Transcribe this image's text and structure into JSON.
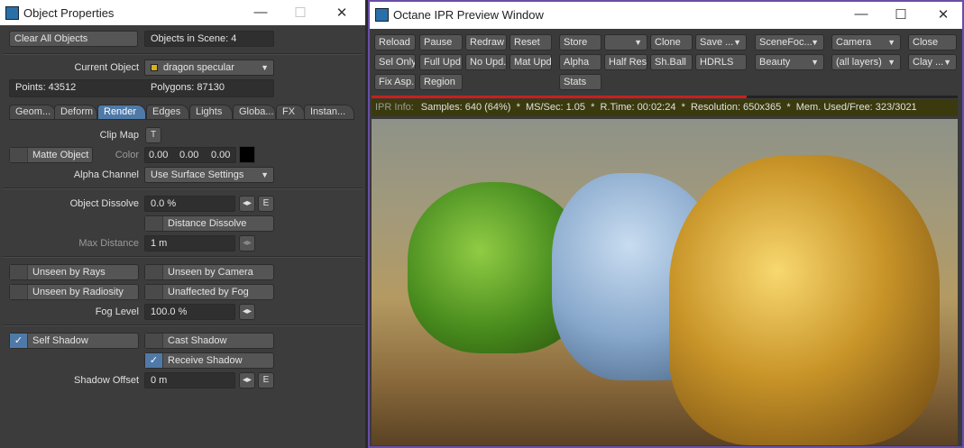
{
  "left": {
    "title": "Object Properties",
    "clear_all": "Clear All Objects",
    "objects_in_scene": "Objects in Scene: 4",
    "current_object_label": "Current Object",
    "current_object": "dragon specular",
    "points": "Points: 43512",
    "polygons": "Polygons: 87130",
    "tabs": [
      "Geom...",
      "Deform",
      "Render",
      "Edges",
      "Lights",
      "Globa...",
      "FX",
      "Instan..."
    ],
    "active_tab": "Render",
    "clip_map_label": "Clip Map",
    "clip_map_btn": "T",
    "matte_object": "Matte Object",
    "color_label": "Color",
    "color_values": [
      "0.00",
      "0.00",
      "0.00"
    ],
    "color_swatch": "#000000",
    "alpha_label": "Alpha Channel",
    "alpha_value": "Use Surface Settings",
    "dissolve_label": "Object Dissolve",
    "dissolve_value": "0.0 %",
    "env_btn": "E",
    "distance_dissolve": "Distance Dissolve",
    "max_distance_label": "Max Distance",
    "max_distance_value": "1 m",
    "unseen_rays": "Unseen by Rays",
    "unseen_camera": "Unseen by Camera",
    "unseen_radiosity": "Unseen by Radiosity",
    "unaffected_fog": "Unaffected by Fog",
    "fog_label": "Fog Level",
    "fog_value": "100.0 %",
    "self_shadow": "Self Shadow",
    "self_shadow_checked": true,
    "cast_shadow": "Cast Shadow",
    "cast_shadow_checked": false,
    "receive_shadow": "Receive Shadow",
    "receive_shadow_checked": true,
    "shadow_offset_label": "Shadow Offset",
    "shadow_offset_value": "0 m"
  },
  "right": {
    "title": "Octane IPR Preview Window",
    "buttons": {
      "reload": "Reload",
      "pause": "Pause",
      "redraw": "Redraw",
      "reset": "Reset",
      "store": "Store",
      "clone": "Clone",
      "save": "Save ...",
      "scene_focus": "SceneFoc...",
      "camera": "Camera",
      "close": "Close",
      "sel_only": "Sel Only",
      "full_upd": "Full Upd.",
      "no_upd": "No Upd.",
      "mat_upd": "Mat Upd",
      "alpha": "Alpha",
      "half_res": "Half Res",
      "sh_ball": "Sh.Ball",
      "hdrls": "HDRLS",
      "beauty": "Beauty",
      "all_layers": "(all layers)",
      "clay": "Clay ...",
      "fix_asp": "Fix Asp.",
      "region": "Region",
      "stats": "Stats"
    },
    "progress_percent": 64,
    "info_label": "IPR Info:",
    "info_text": "Samples: 640 (64%)  *  MS/Sec: 1.05  *  R.Time: 00:02:24  *  Resolution: 650x365  *  Mem. Used/Free: 323/3021"
  },
  "colors": {
    "accent": "#4f7aa8",
    "progress": "#c8201a",
    "info_bg": "#3a3a0e",
    "window_border": "#6a4ea8"
  }
}
